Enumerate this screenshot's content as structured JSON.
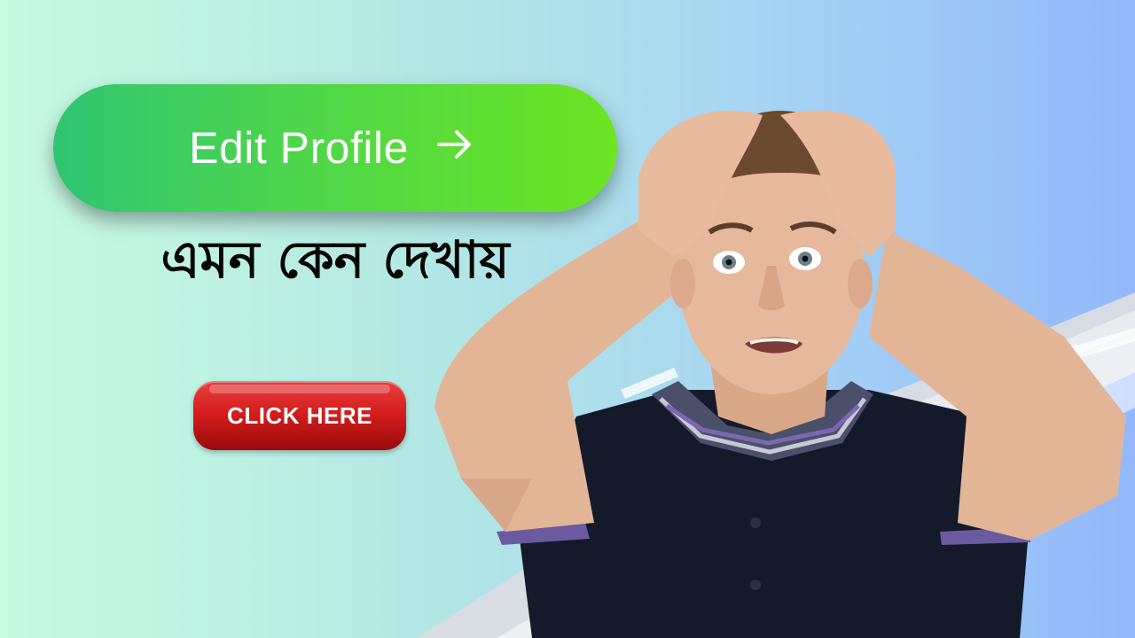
{
  "edit_button": {
    "label": "Edit Profile",
    "icon": "arrow-right-icon"
  },
  "headline": "এমন কেন দেখায়",
  "cta_button": {
    "label": "CLICK HERE"
  },
  "colors": {
    "edit_button_start": "#2fc572",
    "edit_button_end": "#6ce522",
    "cta_button": "#d51e1e",
    "headline": "#050505",
    "shirt": "#141a2a"
  }
}
